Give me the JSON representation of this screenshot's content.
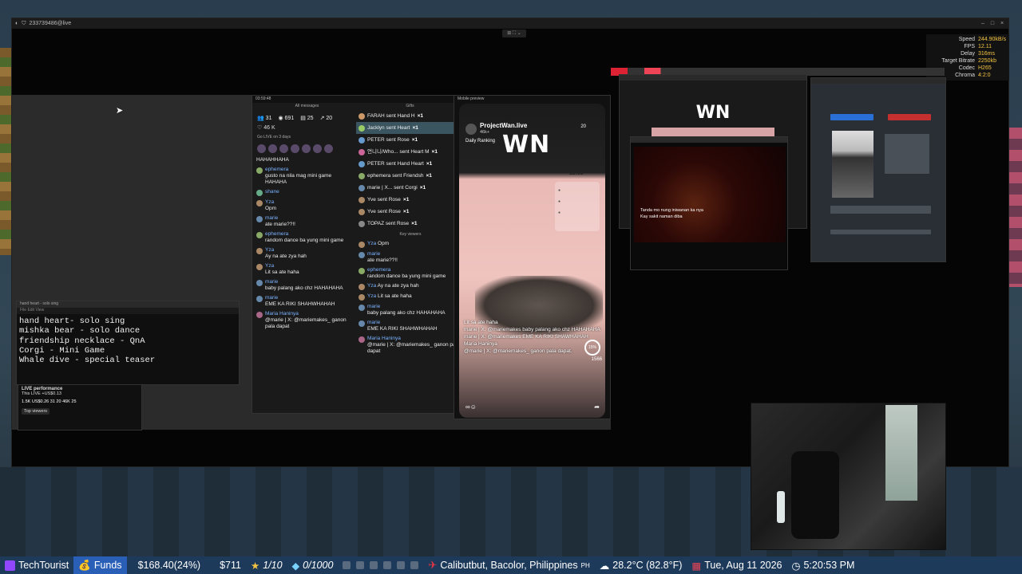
{
  "window": {
    "title": "233739486@live",
    "controls": [
      "–",
      "□",
      "×"
    ]
  },
  "stats": [
    {
      "label": "Speed",
      "value": "244.90kB/s"
    },
    {
      "label": "FPS",
      "value": "12.11"
    },
    {
      "label": "Delay",
      "value": "316ms"
    },
    {
      "label": "Target Bitrate",
      "value": "2250kb"
    },
    {
      "label": "Codec",
      "value": "H265"
    },
    {
      "label": "Chroma",
      "value": "4:2:0"
    }
  ],
  "notes": {
    "title": "hand heart - solo sing",
    "text": "hand heart- solo sing\nmishka bear - solo dance\nfriendship necklace - QnA\nCorgi - Mini Game\nWhale dive - special teaser"
  },
  "live_perf": {
    "title": "LIVE performance",
    "subtitle": "This LIVE +US$0.13",
    "row": "1.5K  US$0.26  31  20  46K  25",
    "tab": "Top viewers"
  },
  "chat": {
    "timer": "03:59:48",
    "head_left": "All messages",
    "head_right": "Gifts",
    "metrics": {
      "viewers": "31",
      "views": "691",
      "comments": "25",
      "shares": "20"
    },
    "likes": "46 K",
    "golive": "Go LIVE on 3 days",
    "messages": [
      {
        "user": "",
        "text": "HAHAHHAHA"
      },
      {
        "user": "ephemera",
        "text": "gusto na nila mag mini game HAHAHA"
      },
      {
        "user": "shane",
        "text": ""
      },
      {
        "user": "Yza",
        "text": "Opm"
      },
      {
        "user": "marie",
        "text": "ate marie??!!"
      },
      {
        "user": "ephemera",
        "text": "random dance ba yung mini game"
      },
      {
        "user": "Yza",
        "text": "Ay na ate zya hah"
      },
      {
        "user": "Yza",
        "text": "Lit sa ate haha"
      },
      {
        "user": "marie",
        "text": "baby palang ako chz HAHAHAHA"
      },
      {
        "user": "marie",
        "text": "EME KA RIKI SHAHWHAHAH"
      },
      {
        "user": "Maria Haninya",
        "text": "@marie | X: @mariemakes_ ganon pala dapat"
      }
    ],
    "gifts": [
      {
        "text": "FARAH sent Hand H",
        "x": "×1"
      },
      {
        "text": "Jacklyn sent Heart",
        "x": "×1"
      },
      {
        "text": "PETER sent Rose",
        "x": "×1"
      },
      {
        "text": "언니니/Who... sent Heart M",
        "x": "×1"
      },
      {
        "text": "PETER sent Hand Heart",
        "x": "×1"
      },
      {
        "text": "ephemera sent Friendsh",
        "x": "×1"
      },
      {
        "text": "marie | X... sent Corgi",
        "x": "×1"
      },
      {
        "text": "Yve sent Rose",
        "x": "×1"
      },
      {
        "text": "Yve sent Rose",
        "x": "×1"
      },
      {
        "text": "TOPAZ sent Rose",
        "x": "×1"
      }
    ],
    "key_viewers_label": "Key viewers",
    "key_viewers": [
      {
        "user": "Yza",
        "text": "Opm"
      },
      {
        "user": "marie",
        "text": "ate marie??!!"
      },
      {
        "user": "ephemera",
        "text": "random dance ba yung mini game"
      },
      {
        "user": "Yza",
        "text": "Ay na ate zya hah"
      },
      {
        "user": "Yza",
        "text": "Lit sa ate haha"
      },
      {
        "user": "marie",
        "text": "baby palang ako chz HAHAHAHA"
      },
      {
        "user": "marie",
        "text": "EME KA RIKI SHAHWHAHAH"
      },
      {
        "user": "Maria Haninya",
        "text": "@marie | X: @mariemakes_ ganon pala dapat"
      }
    ]
  },
  "phone": {
    "window_title": "Mobile preview",
    "name": "ProjectWan.live",
    "likes": "46k+",
    "rank": "Daily Ranking",
    "logo": "WN",
    "count": "20",
    "timer": "11:39",
    "overlay": [
      "Lit sa ate haha",
      "marie | X: @mariemakes baby palang ako chz HAHAHAHA",
      "marie | X: @mariemakes EME KA RIKI SHAWHAHAH",
      "Maria Haninya",
      "@marie | X: @mariemakes_ ganon pala dapat."
    ],
    "pct": "15%",
    "goal": "1566"
  },
  "right_panels": {
    "logo": "WN",
    "lyrics": [
      "Tanda mo nung iniwanan ka nya",
      "Kay sakit naman diba"
    ]
  },
  "taskbar": {
    "channel": "TechTourist",
    "funds_label": "Funds",
    "funds_value": "$168.40(24%)",
    "amount2": "$711",
    "vio": "1/10",
    "gems": "0/1000",
    "location": "Calibutbut, Bacolor, Philippines",
    "country": "PH",
    "weather": "28.2°C (82.8°F)",
    "date": "Tue, Aug 11 2026",
    "time": "5:20:53 PM"
  }
}
